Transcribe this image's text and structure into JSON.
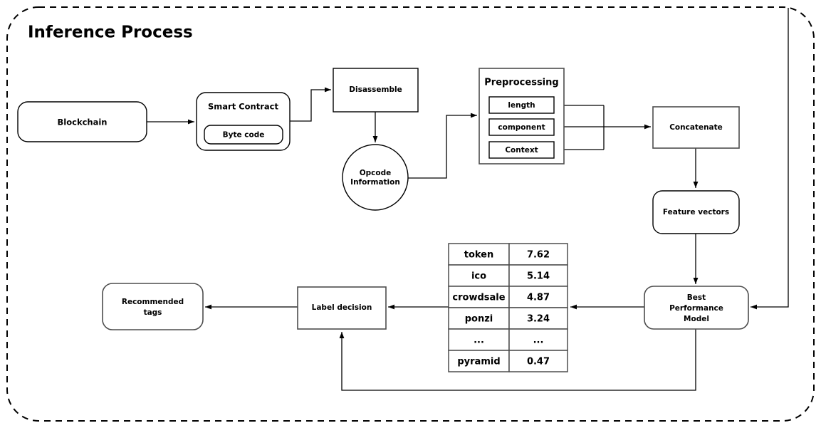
{
  "diagram": {
    "title": "Inference Process",
    "nodes": {
      "blockchain": {
        "label": "Blockchain"
      },
      "smart_contract": {
        "label": "Smart Contract",
        "inner_label": "Byte code"
      },
      "disassemble": {
        "label": "Disassemble"
      },
      "opcode": {
        "label_line1": "Opcode",
        "label_line2": "Information"
      },
      "preprocessing": {
        "label": "Preprocessing",
        "features": [
          "length",
          "component",
          "Context"
        ]
      },
      "concatenate": {
        "label": "Concatenate"
      },
      "feature_vectors": {
        "label": "Feature vectors"
      },
      "best_model": {
        "label_line1": "Best",
        "label_line2": "Performance",
        "label_line3": "Model"
      },
      "label_decision": {
        "label": "Label decision"
      },
      "recommended_tags": {
        "label_line1": "Recommended",
        "label_line2": "tags"
      }
    },
    "score_table": {
      "rows": [
        {
          "tag": "token",
          "score": "7.62"
        },
        {
          "tag": "ico",
          "score": "5.14"
        },
        {
          "tag": "crowdsale",
          "score": "4.87"
        },
        {
          "tag": "ponzi",
          "score": "3.24"
        },
        {
          "tag": "...",
          "score": "..."
        },
        {
          "tag": "pyramid",
          "score": "0.47"
        }
      ]
    },
    "colors": {
      "stroke": "#000000",
      "stroke_gray": "#4d4d4d",
      "background": "#ffffff"
    }
  }
}
